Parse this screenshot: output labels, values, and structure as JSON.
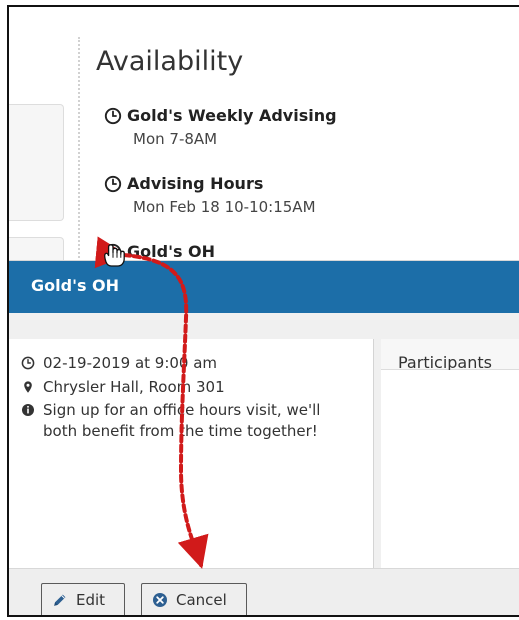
{
  "availability": {
    "title": "Availability",
    "items": [
      {
        "name": "Gold's Weekly Advising",
        "time": "Mon 7-8AM"
      },
      {
        "name": "Advising Hours",
        "time": "Mon Feb 18 10-10:15AM"
      },
      {
        "name": "Gold's OH"
      }
    ]
  },
  "modal": {
    "title": "Gold's OH",
    "details": {
      "date": "02-19-2019 at 9:00 am",
      "location": "Chrysler Hall, Room 301",
      "description": "Sign up for an office hours visit, we'll both benefit from the time together!"
    },
    "participants_label": "Participants",
    "buttons": {
      "edit_label": "Edit",
      "cancel_label": "Cancel"
    }
  },
  "colors": {
    "header_blue": "#1c6ea8",
    "annotation_red": "#d11a1a"
  },
  "icons": {
    "clock": "clock-icon",
    "pin": "map-pin-icon",
    "info": "info-icon",
    "pencil": "pencil-icon",
    "cancel": "cancel-icon",
    "cursor": "hand-cursor-icon"
  }
}
